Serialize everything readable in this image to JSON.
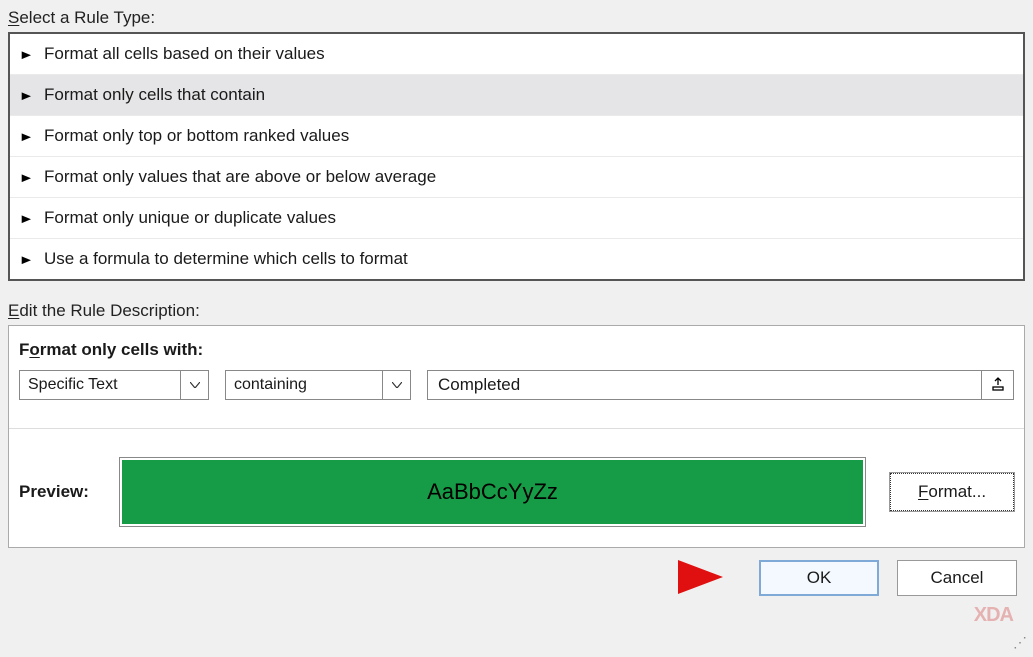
{
  "labels": {
    "select_rule_type": "Select a Rule Type:",
    "edit_description": "Edit the Rule Description:",
    "format_only_with": "Format only cells with:",
    "preview": "Preview:",
    "format_button": "Format...",
    "ok": "OK",
    "cancel": "Cancel"
  },
  "rule_types": [
    {
      "label": "Format all cells based on their values",
      "selected": false
    },
    {
      "label": "Format only cells that contain",
      "selected": true
    },
    {
      "label": "Format only top or bottom ranked values",
      "selected": false
    },
    {
      "label": "Format only values that are above or below average",
      "selected": false
    },
    {
      "label": "Format only unique or duplicate values",
      "selected": false
    },
    {
      "label": "Use a formula to determine which cells to format",
      "selected": false
    }
  ],
  "criteria": {
    "type": "Specific Text",
    "operator": "containing",
    "value": "Completed"
  },
  "preview": {
    "sample_text": "AaBbCcYyZz",
    "background": "#169c46",
    "foreground": "#000000"
  },
  "watermark": "XDA"
}
